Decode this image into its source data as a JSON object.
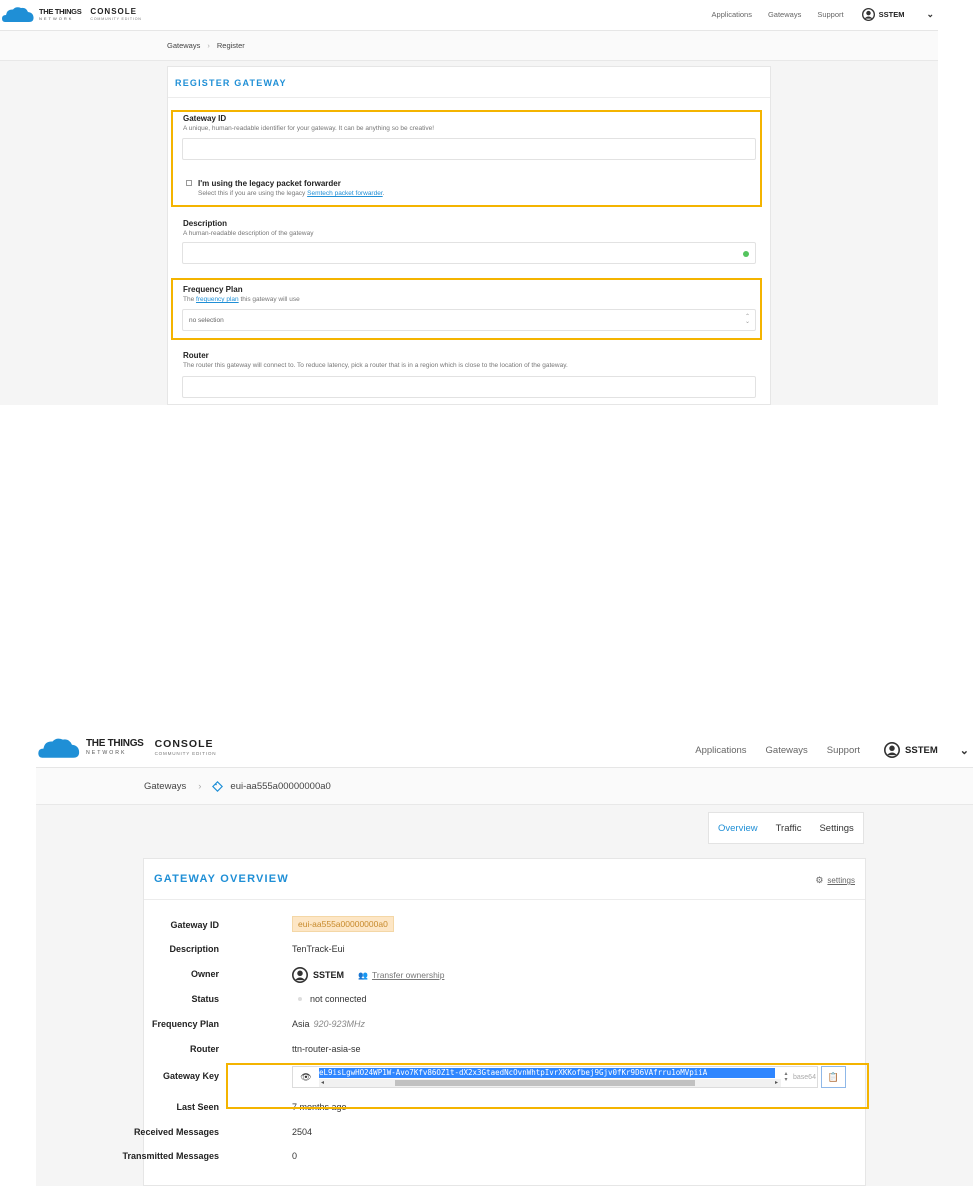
{
  "brand": {
    "name": "THE THINGS",
    "network": "NETWORK",
    "console": "CONSOLE",
    "edition": "COMMUNITY EDITION"
  },
  "nav": {
    "applications": "Applications",
    "gateways": "Gateways",
    "support": "Support",
    "user": "SSTEM",
    "caret": "⌄"
  },
  "register": {
    "breadcrumb": [
      "Gateways",
      "Register"
    ],
    "title": "REGISTER GATEWAY",
    "gateway_id": {
      "label": "Gateway ID",
      "help": "A unique, human-readable identifier for your gateway. It can be anything so be creative!",
      "value": ""
    },
    "legacy": {
      "label": "I'm using the legacy packet forwarder",
      "help_prefix": "Select this if you are using the legacy ",
      "help_link": "Semtech packet forwarder",
      "help_suffix": "."
    },
    "description": {
      "label": "Description",
      "help": "A human-readable description of the gateway",
      "value": ""
    },
    "frequency_plan": {
      "label": "Frequency Plan",
      "help_prefix": "The ",
      "help_link": "frequency plan",
      "help_suffix": " this gateway will use",
      "selected": "no selection"
    },
    "router": {
      "label": "Router",
      "help": "The router this gateway will connect to. To reduce latency, pick a router that is in a region which is close to the location of the gateway.",
      "value": ""
    }
  },
  "overview": {
    "breadcrumb": [
      "Gateways",
      "eui-aa555a00000000a0"
    ],
    "tabs": [
      {
        "label": "Overview",
        "active": true
      },
      {
        "label": "Traffic",
        "active": false
      },
      {
        "label": "Settings",
        "active": false
      }
    ],
    "title": "GATEWAY OVERVIEW",
    "settings_link": "settings",
    "rows": {
      "gateway_id": {
        "label": "Gateway ID",
        "value": "eui-aa555a00000000a0"
      },
      "description": {
        "label": "Description",
        "value": "TenTrack-Eui"
      },
      "owner": {
        "label": "Owner",
        "value": "SSTEM",
        "transfer": "Transfer ownership"
      },
      "status": {
        "label": "Status",
        "value": "not connected"
      },
      "frequency_plan": {
        "label": "Frequency Plan",
        "value": "Asia",
        "range": "920-923MHz"
      },
      "router": {
        "label": "Router",
        "value": "ttn-router-asia-se"
      },
      "gateway_key": {
        "label": "Gateway Key",
        "value": "eL9isLgwHO24WP1W-Avo7Kfv86OZ1t-dX2x3GtaedNcOvnWhtpIvrXKKofbej9Gjv0fKr9D6VAfrru1oMVpiiA",
        "encoding": "base64"
      },
      "last_seen": {
        "label": "Last Seen",
        "value": "7 months ago"
      },
      "received": {
        "label": "Received Messages",
        "value": "2504"
      },
      "transmitted": {
        "label": "Transmitted Messages",
        "value": "0"
      }
    }
  },
  "colors": {
    "accent": "#1f8fd6",
    "highlight": "#f4b400",
    "badge_bg": "#fde6c5"
  }
}
